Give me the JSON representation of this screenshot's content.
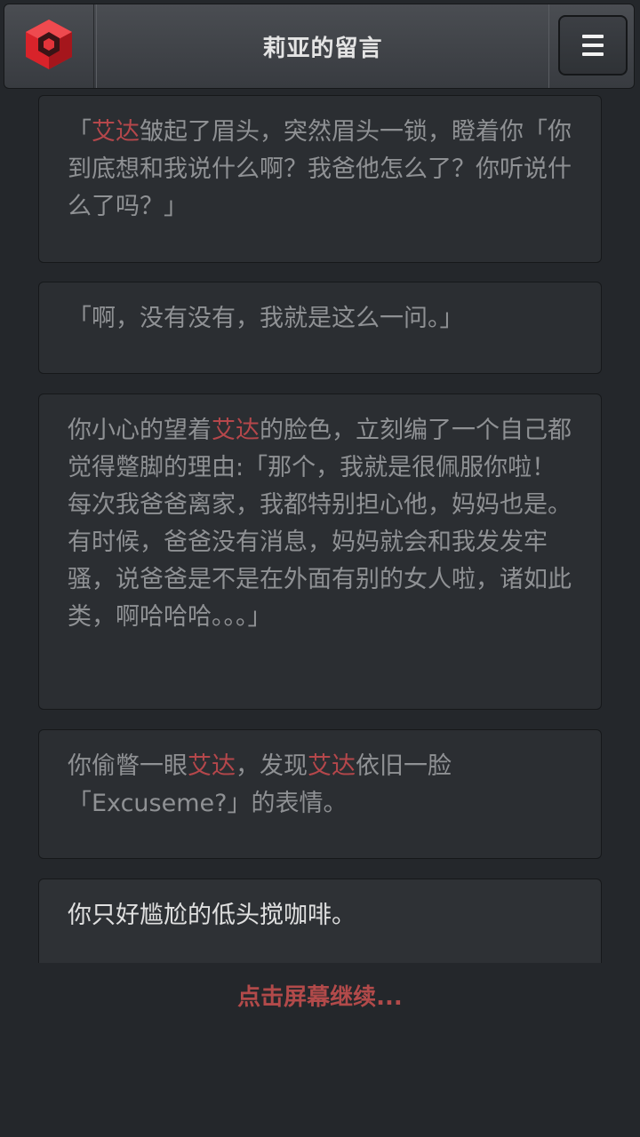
{
  "header": {
    "logo_icon": "red-cube-logo-icon",
    "title": "莉亚的留言",
    "menu_icon": "hamburger-menu-icon"
  },
  "messages": [
    {
      "parts": [
        {
          "text": "「",
          "highlight": false
        },
        {
          "text": "艾达",
          "highlight": true
        },
        {
          "text": "皱起了眉头，突然眉头一锁，瞪着你「你到底想和我说什么啊？我爸他怎么了？你听说什么了吗？」",
          "highlight": false
        }
      ]
    },
    {
      "parts": [
        {
          "text": "「啊，没有没有，我就是这么一问。」",
          "highlight": false
        }
      ]
    },
    {
      "parts": [
        {
          "text": "你小心的望着",
          "highlight": false
        },
        {
          "text": "艾达",
          "highlight": true
        },
        {
          "text": "的脸色，立刻编了一个自己都觉得蹩脚的理由:「那个，我就是很佩服你啦！每次我爸爸离家，我都特别担心他，妈妈也是。有时候，爸爸没有消息，妈妈就会和我发发牢骚，说爸爸是不是在外面有别的女人啦，诸如此类，啊哈哈哈。。。」",
          "highlight": false
        }
      ]
    },
    {
      "parts": [
        {
          "text": "你偷瞥一眼",
          "highlight": false
        },
        {
          "text": "艾达",
          "highlight": true
        },
        {
          "text": "，发现",
          "highlight": false
        },
        {
          "text": "艾达",
          "highlight": true
        },
        {
          "text": "依旧一脸「Excuseme?」的表情。",
          "highlight": false
        }
      ]
    },
    {
      "parts": [
        {
          "text": "你只好尴尬的低头搅咖啡。",
          "highlight": false
        }
      ]
    }
  ],
  "continue_label": "点击屏幕继续...",
  "colors": {
    "accent_red": "#b5474b",
    "background": "#24272b",
    "card": "#2b2e32"
  }
}
